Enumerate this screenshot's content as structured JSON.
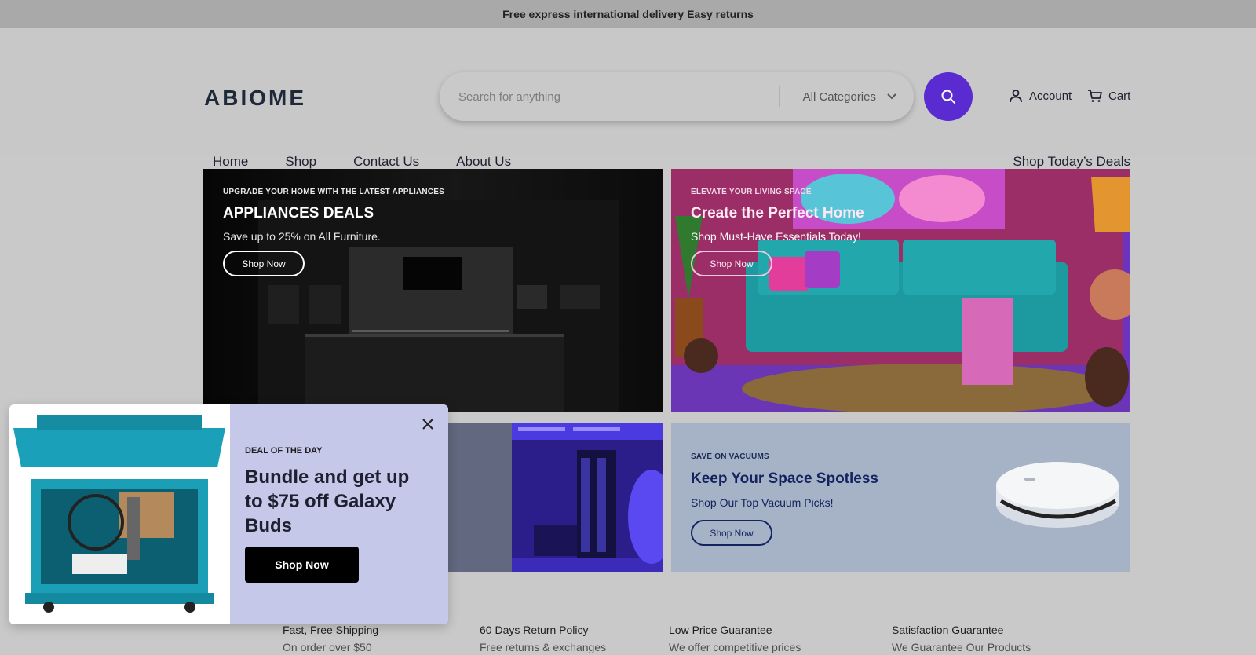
{
  "announcement": "Free express international delivery Easy returns",
  "brand": {
    "logo": "ABIOME"
  },
  "search": {
    "placeholder": "Search for anything",
    "category": "All Categories"
  },
  "header_links": {
    "account": "Account",
    "cart": "Cart"
  },
  "nav": {
    "items": [
      "Home",
      "Shop",
      "Contact Us",
      "About Us"
    ],
    "deals": "Shop Today’s Deals"
  },
  "banners": [
    {
      "eyebrow": "UPGRADE YOUR HOME WITH THE LATEST APPLIANCES",
      "title": "APPLIANCES DEALS",
      "subtitle": "Save up to 25% on All Furniture.",
      "button": "Shop Now"
    },
    {
      "eyebrow": "ELEVATE YOUR LIVING SPACE",
      "title": "Create the Perfect Home",
      "subtitle": "Shop Must-Have Essentials Today!",
      "button": "Shop Now"
    },
    {
      "eyebrow": "SAVE ON VACUUMS",
      "title": "Keep Your Space Spotless",
      "subtitle": "Shop Our Top Vacuum Picks!",
      "button": "Shop Now"
    }
  ],
  "features": [
    {
      "title": "Fast, Free Shipping",
      "subtitle": "On order over $50"
    },
    {
      "title": "60 Days Return Policy",
      "subtitle": "Free returns & exchanges"
    },
    {
      "title": "Low Price Guarantee",
      "subtitle": "We offer competitive prices"
    },
    {
      "title": "Satisfaction Guarantee",
      "subtitle": "We Guarantee Our Products"
    }
  ],
  "popup": {
    "eyebrow": "DEAL OF THE DAY",
    "title": "Bundle and get up to $75 off Galaxy Buds",
    "button": "Shop Now"
  },
  "colors": {
    "accent": "#5a2bd0",
    "popup_bg": "#c5c8e8",
    "page_bg": "#c9c9c9"
  }
}
